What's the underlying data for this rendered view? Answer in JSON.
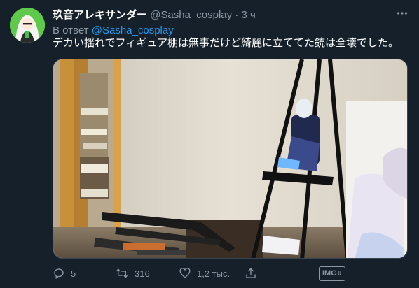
{
  "author": {
    "display_name": "玖音アレキサンダー",
    "handle": "@Sasha_cosplay",
    "separator": "·",
    "time": "3 ч"
  },
  "reply": {
    "prefix": "В ответ",
    "mention": "@Sasha_cosplay"
  },
  "tweet_text": "デカい揺れでフィギュア棚は無事だけど綺麗に立ててた銃は全壊でした。",
  "actions": {
    "replies": "5",
    "retweets": "316",
    "likes": "1,2 тыс."
  },
  "extension_badge": "IMG",
  "colors": {
    "background": "#15202b",
    "secondary_text": "#8b98a5",
    "link": "#1d9bf0",
    "avatar_bg": "#5fc94a"
  },
  "icons": {
    "more": "more-dots-icon",
    "reply": "reply-icon",
    "retweet": "retweet-icon",
    "like": "heart-icon",
    "share": "share-icon"
  }
}
